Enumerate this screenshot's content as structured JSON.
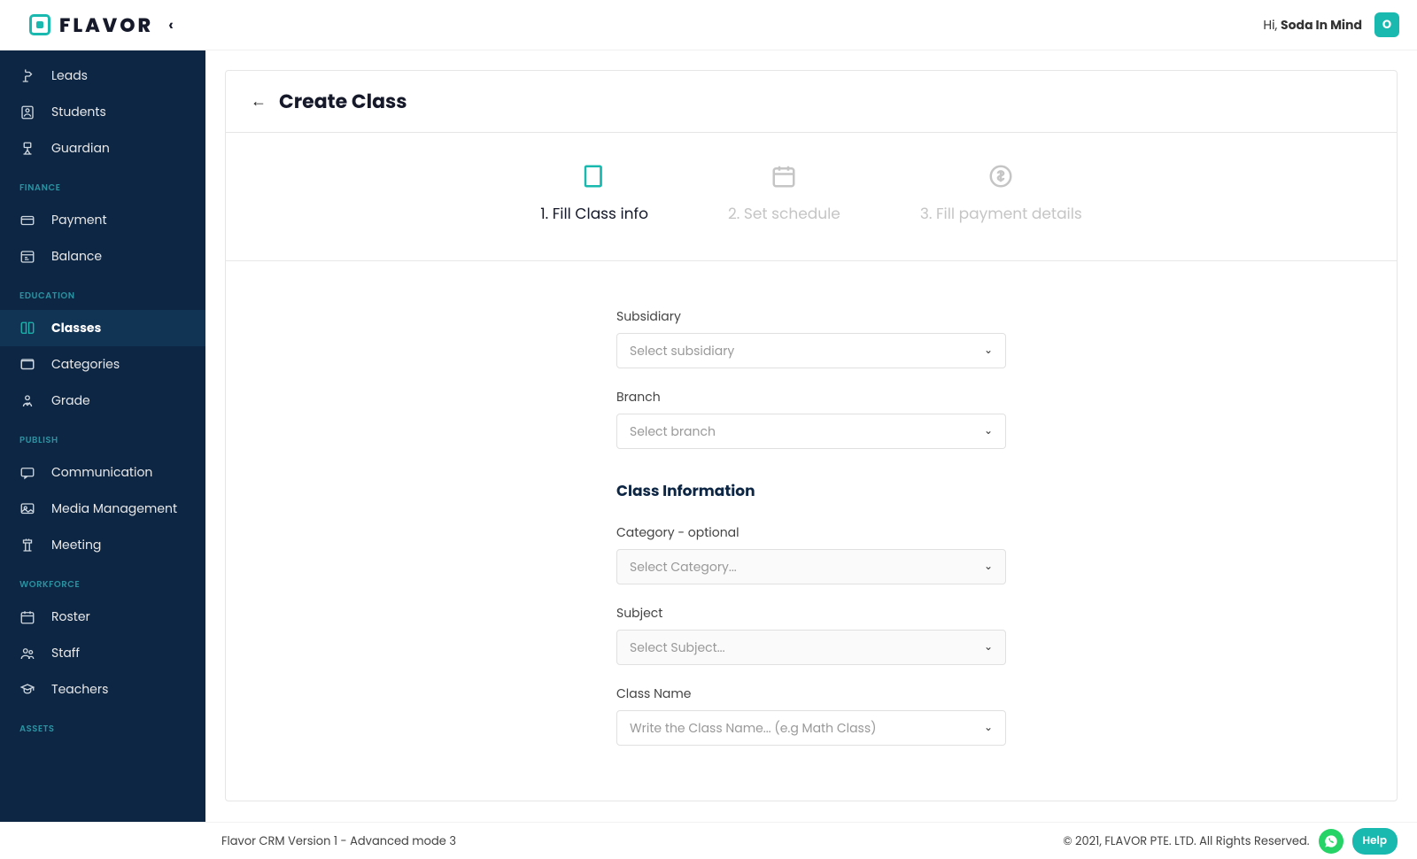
{
  "header": {
    "brand": "FLAVOR",
    "greeting_prefix": "Hi, ",
    "username": "Soda In Mind",
    "avatar_initial": "O"
  },
  "sidebar": {
    "sections": [
      {
        "items": [
          {
            "label": "Leads",
            "icon": "lead"
          },
          {
            "label": "Students",
            "icon": "student"
          },
          {
            "label": "Guardian",
            "icon": "guardian"
          }
        ]
      },
      {
        "title": "FINANCE",
        "items": [
          {
            "label": "Payment",
            "icon": "card"
          },
          {
            "label": "Balance",
            "icon": "balance"
          }
        ]
      },
      {
        "title": "EDUCATION",
        "items": [
          {
            "label": "Classes",
            "icon": "book",
            "active": true
          },
          {
            "label": "Categories",
            "icon": "cat"
          },
          {
            "label": "Grade",
            "icon": "grade"
          }
        ]
      },
      {
        "title": "PUBLISH",
        "items": [
          {
            "label": "Communication",
            "icon": "comm"
          },
          {
            "label": "Media Management",
            "icon": "media"
          },
          {
            "label": "Meeting",
            "icon": "meet"
          }
        ]
      },
      {
        "title": "WORKFORCE",
        "items": [
          {
            "label": "Roster",
            "icon": "cal"
          },
          {
            "label": "Staff",
            "icon": "staff"
          },
          {
            "label": "Teachers",
            "icon": "teacher"
          }
        ]
      },
      {
        "title": "ASSETS",
        "items": []
      }
    ]
  },
  "page": {
    "title": "Create Class",
    "steps": [
      {
        "label": "1. Fill Class info",
        "icon": "info",
        "active": true
      },
      {
        "label": "2. Set schedule",
        "icon": "calendar",
        "active": false
      },
      {
        "label": "3. Fill payment details",
        "icon": "dollar",
        "active": false
      }
    ],
    "fields": {
      "subsidiary": {
        "label": "Subsidiary",
        "placeholder": "Select subsidiary"
      },
      "branch": {
        "label": "Branch",
        "placeholder": "Select branch"
      },
      "section": "Class Information",
      "category": {
        "label": "Category - optional",
        "placeholder": "Select Category..."
      },
      "subject": {
        "label": "Subject",
        "placeholder": "Select Subject..."
      },
      "classname": {
        "label": "Class Name",
        "placeholder": "Write the Class Name... (e.g Math Class)"
      }
    }
  },
  "footer": {
    "version": "Flavor CRM Version 1 - Advanced mode 3",
    "copyright": "© 2021, FLAVOR PTE. LTD. All Rights Reserved.",
    "help": "Help"
  }
}
